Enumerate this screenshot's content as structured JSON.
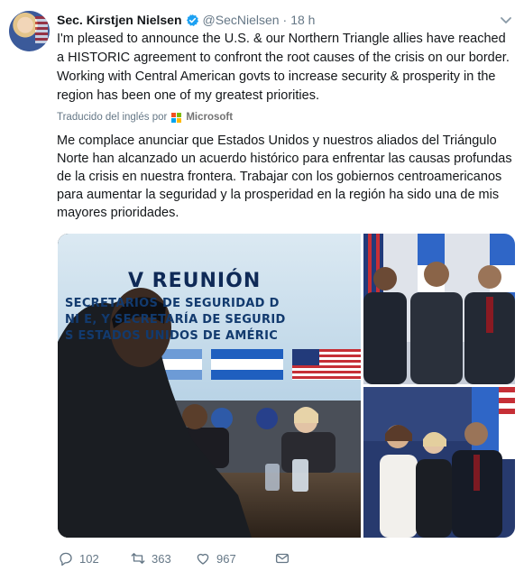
{
  "author": {
    "name": "Sec. Kirstjen Nielsen",
    "handle": "@SecNielsen",
    "separator": "·",
    "time": "18 h"
  },
  "tweet": {
    "text": "I'm pleased to announce the U.S. & our Northern Triangle allies have reached a HISTORIC agreement to confront the root causes of the crisis on our border. Working with Central American govts to increase security & prosperity in the region has been one of my greatest priorities."
  },
  "translation": {
    "label": "Traducido del inglés por",
    "provider": "Microsoft",
    "text": "Me complace anunciar que Estados Unidos y nuestros aliados del Triángulo Norte han alcanzado un acuerdo histórico para enfrentar las causas profundas de la crisis en nuestra frontera. Trabajar con los gobiernos centroamericanos para aumentar la seguridad y la prosperidad en la región ha sido una de mis mayores prioridades."
  },
  "media": {
    "banner_title": "V REUNIÓN",
    "banner_lines": [
      "SECRETARIOS DE SEGURIDAD D",
      "NI                E, Y SECRETARÍA DE SEGURID",
      "                    S ESTADOS UNIDOS DE AMÉRIC"
    ]
  },
  "actions": {
    "replies": "102",
    "retweets": "363",
    "likes": "967"
  },
  "colors": {
    "verified": "#1da1f2",
    "text": "#14171a",
    "muted": "#657786"
  }
}
